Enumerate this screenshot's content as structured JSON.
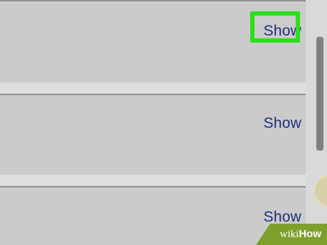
{
  "list": {
    "rows": [
      {
        "action_label": "Show",
        "highlighted": true
      },
      {
        "action_label": "Show",
        "highlighted": false
      },
      {
        "action_label": "Show",
        "highlighted": false
      }
    ]
  },
  "watermark": {
    "prefix": "wiki",
    "suffix": "How"
  },
  "colors": {
    "highlight": "#29e01a",
    "link": "#1d2f7a",
    "row_background": "#cbcbcb"
  }
}
